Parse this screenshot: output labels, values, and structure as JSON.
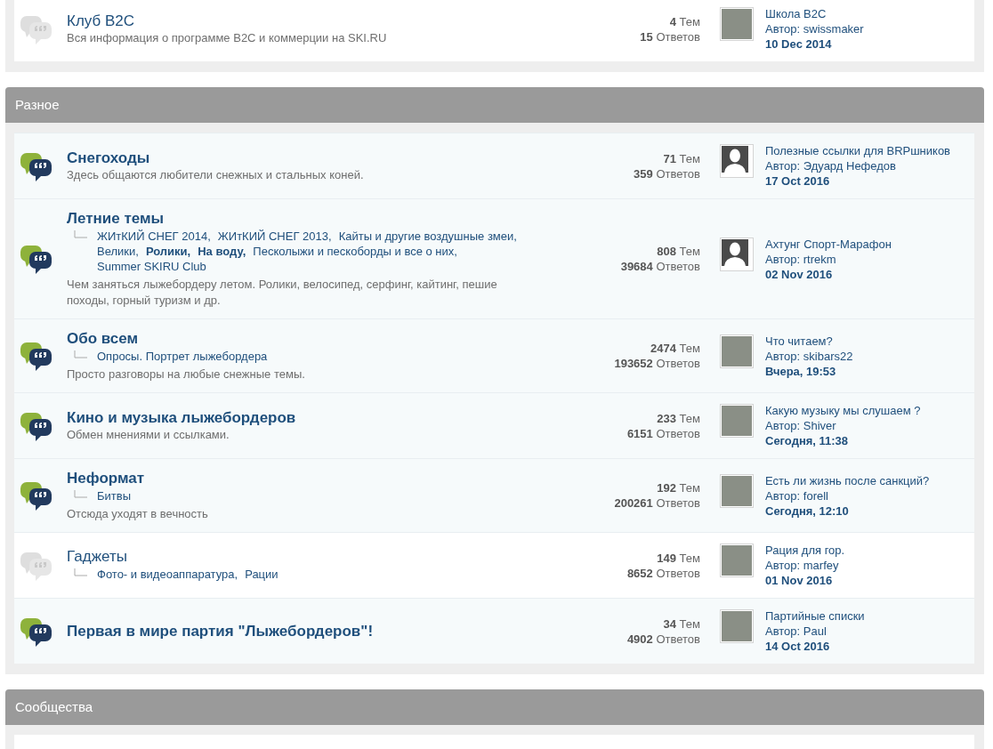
{
  "sections": [
    {
      "forums": [
        {
          "unread": false,
          "title": "Клуб B2C",
          "description": "Вся информация о программе B2C и коммерции на SKI.RU",
          "topics": "**4** Тем",
          "posts": "**15** Ответов",
          "last_post": {
            "kind": "photo",
            "title": "Школа B2C",
            "author": "Автор: swissmaker",
            "date": "10 Dec 2014"
          }
        }
      ]
    },
    {
      "title": "Разное",
      "forums": [
        {
          "unread": true,
          "title": "Снегоходы",
          "description": "Здесь общаются любители снежных и стальных коней.",
          "topics": "**71** Тем",
          "posts": "**359** Ответов",
          "last_post": {
            "kind": "silhouette",
            "title": "Полезные ссылки для BRPшников",
            "author": "Автор: Эдуард Нефедов",
            "date": "17 Oct 2016"
          }
        },
        {
          "unread": true,
          "title": "Летние темы",
          "subforums": [
            {
              "label": "ЖИтКИЙ СНЕГ 2014,",
              "bold": false
            },
            {
              "label": "ЖИтКИЙ СНЕГ 2013,",
              "bold": false
            },
            {
              "label": "Кайты и другие воздушные змеи,",
              "bold": false
            },
            {
              "label": "Велики,",
              "bold": false
            },
            {
              "label": "Ролики,",
              "bold": true
            },
            {
              "label": "На воду,",
              "bold": true
            },
            {
              "label": "Песколыжи и пескоборды и все о них,",
              "bold": false
            },
            {
              "label": "Summer SKIRU Club",
              "bold": false
            }
          ],
          "description": "Чем заняться лыжебордеру летом. Ролики, велосипед, серфинг, кайтинг, пешие походы, горный туризм и др.",
          "topics": "**808** Тем",
          "posts": "**39684** Ответов",
          "last_post": {
            "kind": "silhouette",
            "title": "Ахтунг Спорт-Марафон",
            "author": "Автор: rtrekm",
            "date": "02 Nov 2016"
          }
        },
        {
          "unread": true,
          "title": "Обо всем",
          "subforums": [
            {
              "label": "Опросы. Портрет лыжебордера",
              "bold": false
            }
          ],
          "description": "Просто разговоры на любые снежные темы.",
          "topics": "**2474** Тем",
          "posts": "**193652** Ответов",
          "last_post": {
            "kind": "photo",
            "title": "Что читаем?",
            "author": "Автор: skibars22",
            "date": "Вчера, 19:53"
          }
        },
        {
          "unread": true,
          "title": "Кино и музыка лыжебордеров",
          "description": "Обмен мнениями и ссылками.",
          "topics": "**233** Тем",
          "posts": "**6151** Ответов",
          "last_post": {
            "kind": "photo",
            "title": "Какую музыку мы слушаем ?",
            "author": "Автор: Shiver",
            "date": "Сегодня, 11:38"
          }
        },
        {
          "unread": true,
          "title": "Неформат",
          "subforums": [
            {
              "label": "Битвы",
              "bold": false
            }
          ],
          "description": "Отсюда уходят в вечность",
          "topics": "**192** Тем",
          "posts": "**200261** Ответов",
          "last_post": {
            "kind": "photo",
            "title": "Есть ли жизнь после санкций?",
            "author": "Автор: forell",
            "date": "Сегодня, 12:10"
          }
        },
        {
          "unread": false,
          "title": "Гаджеты",
          "subforums": [
            {
              "label": "Фото- и видеоаппаратура,",
              "bold": false
            },
            {
              "label": "Рации",
              "bold": false
            }
          ],
          "topics": "**149** Тем",
          "posts": "**8652** Ответов",
          "last_post": {
            "kind": "photo",
            "title": "Рация для гор.",
            "author": "Автор: marfey",
            "date": "01 Nov 2016"
          }
        },
        {
          "unread": true,
          "title": "Первая в мире партия \"Лыжебордеров\"!",
          "topics": "**34** Тем",
          "posts": "**4902** Ответов",
          "last_post": {
            "kind": "photo",
            "title": "Партийные списки",
            "author": "Автор: Paul",
            "date": "14 Oct 2016"
          }
        }
      ]
    },
    {
      "title": "Сообщества"
    }
  ]
}
